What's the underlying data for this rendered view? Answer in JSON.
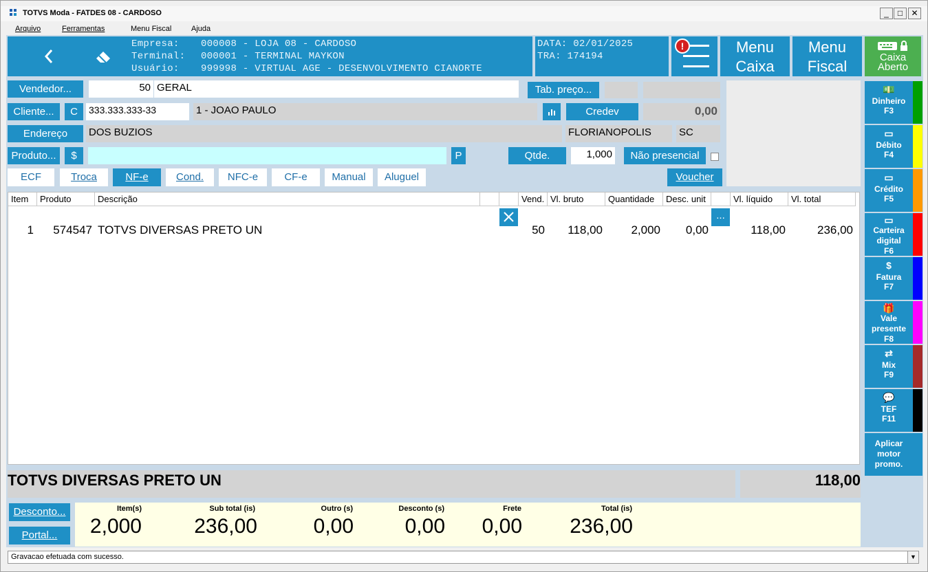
{
  "window": {
    "title": "TOTVS Moda - FATDES 08 - CARDOSO",
    "minimize": "_",
    "maximize": "□",
    "close": "✕"
  },
  "menu": {
    "arquivo": "Arquivo",
    "ferramentas": "Ferramentas",
    "menu_fiscal": "Menu Fiscal",
    "ajuda": "Ajuda"
  },
  "header": {
    "back_icon": "chevron-left",
    "eraser_icon": "eraser",
    "empresa_label": "Empresa:",
    "empresa_value": "000008 - LOJA 08 - CARDOSO",
    "terminal_label": "Terminal:",
    "terminal_value": "000001 - TERMINAL MAYKON",
    "usuario_label": "Usuário:",
    "usuario_value": "999998 - VIRTUAL AGE - DESENVOLVIMENTO CIANORTE",
    "data_line": "DATA: 02/01/2025",
    "tra_line": "TRA: 174194",
    "alert_badge": "!",
    "menu_caixa_1": "Menu",
    "menu_caixa_2": "Caixa",
    "menu_fiscal_1": "Menu",
    "menu_fiscal_2": "Fiscal",
    "caixa_aberto_1": "Caixa",
    "caixa_aberto_2": "Aberto"
  },
  "form": {
    "vendedor_btn": "Vendedor...",
    "vendedor_code": "50",
    "vendedor_name": "GERAL",
    "tab_preco_btn": "Tab. preço...",
    "cliente_btn": "Cliente...",
    "c_btn": "C",
    "cliente_cpf": "333.333.333-33",
    "cliente_name": "1 - JOAO PAULO",
    "credev_btn": "Credev",
    "credev_value": "0,00",
    "endereco_btn": "Endereço",
    "endereco_value": "DOS BUZIOS",
    "cidade": "FLORIANOPOLIS",
    "uf": "SC",
    "produto_btn": "Produto...",
    "dollar_btn": "$",
    "p_btn": "P",
    "qtde_btn": "Qtde.",
    "qtde_value": "1,000",
    "nao_presencial": "Não presencial"
  },
  "tabs": {
    "ecf": "ECF",
    "troca": "Troca",
    "nfe": "NF-e",
    "cond": "Cond.",
    "nfce": "NFC-e",
    "cfe": "CF-e",
    "manual": "Manual",
    "aluguel": "Aluguel",
    "voucher": "Voucher"
  },
  "grid": {
    "headers": {
      "item": "Item",
      "produto": "Produto",
      "descricao": "Descrição",
      "vend": "Vend.",
      "vl_bruto": "Vl. bruto",
      "quantidade": "Quantidade",
      "desc_unit": "Desc. unit",
      "vl_liquido": "Vl. líquido",
      "vl_total": "Vl. total"
    },
    "rows": [
      {
        "item": "1",
        "produto": "574547",
        "descricao": "TOTVS DIVERSAS PRETO UN",
        "vend": "50",
        "vl_bruto": "118,00",
        "quantidade": "2,000",
        "desc_unit": "0,00",
        "more": "...",
        "vl_liquido": "118,00",
        "vl_total": "236,00"
      }
    ]
  },
  "selected_product": {
    "name": "TOTVS DIVERSAS PRETO UN",
    "value": "118,00"
  },
  "bottom": {
    "desconto_btn": "Desconto...",
    "portal_btn": "Portal...",
    "items_label": "Item(s)",
    "items_value": "2,000",
    "subtotal_label": "Sub total (is)",
    "subtotal_value": "236,00",
    "outro_label": "Outro (s)",
    "outro_value": "0,00",
    "desconto_label": "Desconto (s)",
    "desconto_value": "0,00",
    "frete_label": "Frete",
    "frete_value": "0,00",
    "total_label": "Total (is)",
    "total_value": "236,00"
  },
  "payments": [
    {
      "l1": "Dinheiro",
      "l2": "F3",
      "l3": "",
      "color": "#00a000"
    },
    {
      "l1": "Débito",
      "l2": "F4",
      "l3": "",
      "color": "#ffff00"
    },
    {
      "l1": "Crédito",
      "l2": "F5",
      "l3": "",
      "color": "#ff9900"
    },
    {
      "l1": "Carteira",
      "l2": "digital",
      "l3": "F6",
      "color": "#ff0000"
    },
    {
      "l1": "Fatura",
      "l2": "F7",
      "l3": "",
      "color": "#0000ff"
    },
    {
      "l1": "Vale",
      "l2": "presente",
      "l3": "F8",
      "color": "#ff00ff"
    },
    {
      "l1": "Mix",
      "l2": "F9",
      "l3": "",
      "color": "#a52a2a"
    },
    {
      "l1": "TEF",
      "l2": "F11",
      "l3": "",
      "color": "#000000"
    }
  ],
  "aplicar_motor": {
    "l1": "Aplicar",
    "l2": "motor",
    "l3": "promo."
  },
  "status": {
    "message": "Gravacao efetuada com sucesso."
  }
}
